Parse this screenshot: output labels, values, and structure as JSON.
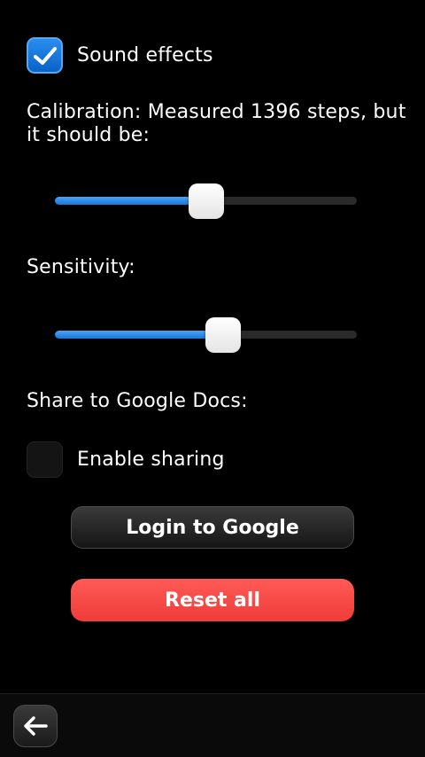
{
  "sound_effects": {
    "label": "Sound effects",
    "checked": true
  },
  "calibration": {
    "label": "Calibration: Measured 1396 steps, but it should be:",
    "value_fraction": 0.5
  },
  "sensitivity": {
    "label": "Sensitivity:",
    "value_fraction": 0.556
  },
  "share": {
    "label": "Share to Google Docs:",
    "enable_sharing": {
      "label": "Enable sharing",
      "checked": false
    }
  },
  "buttons": {
    "login_label": "Login to Google",
    "reset_label": "Reset all"
  },
  "toolbar": {
    "back_icon": "back-arrow-icon"
  },
  "colors": {
    "accent": "#1a7fe0",
    "danger": "#f5453f",
    "background": "#000000"
  }
}
